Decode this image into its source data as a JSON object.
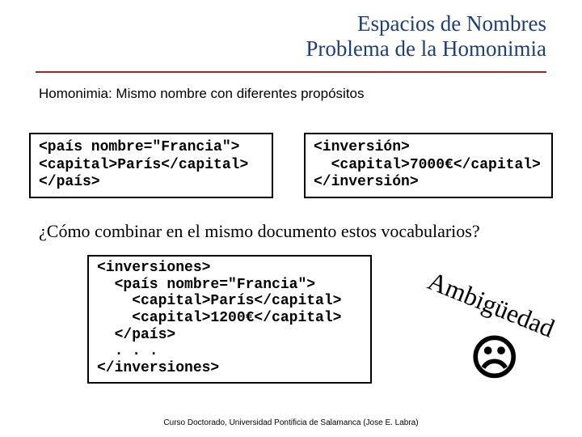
{
  "title": {
    "line1": "Espacios de Nombres",
    "line2": "Problema de la Homonimia"
  },
  "subtitle": "Homonimia: Mismo nombre con diferentes propósitos",
  "code_left": "<país nombre=\"Francia\">\n<capital>París</capital>\n</país>",
  "code_right": "<inversión>\n  <capital>7000€</capital>\n</inversión>",
  "question": "¿Cómo combinar en el mismo documento estos vocabularios?",
  "code_bottom": "<inversiones>\n  <país nombre=\"Francia\">\n    <capital>París</capital>\n    <capital>1200€</capital>\n  </país>\n  . . .\n</inversiones>",
  "ambig_label": "Ambigüedad",
  "sad_face": "☹",
  "footer": "Curso Doctorado, Universidad Pontificia de Salamanca (Jose E. Labra)"
}
